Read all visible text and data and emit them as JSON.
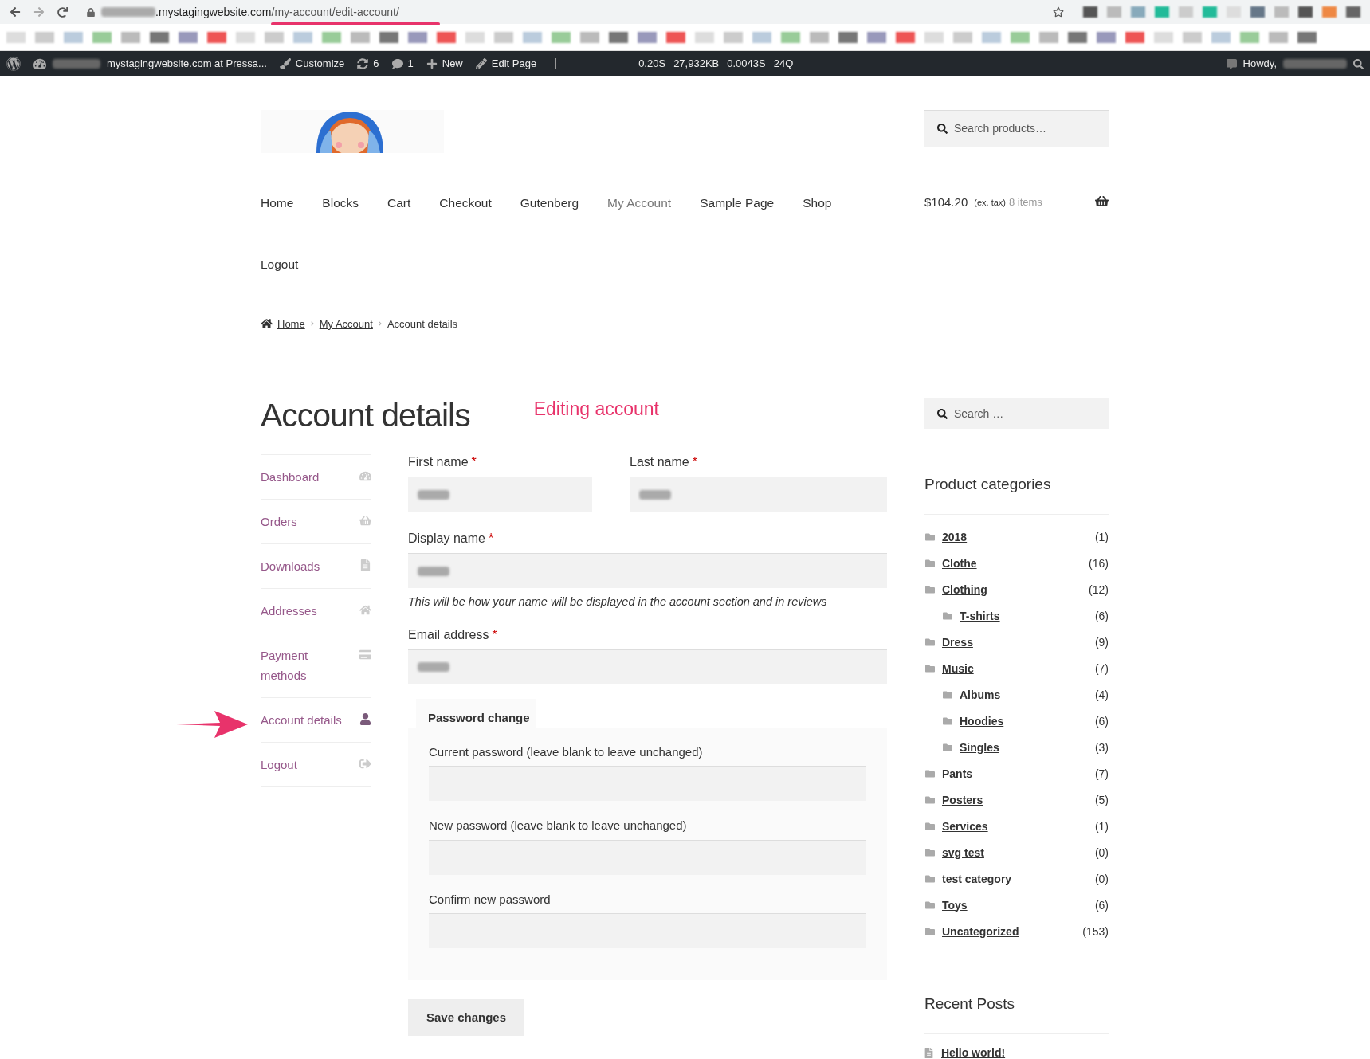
{
  "browser": {
    "url_host": ".mystagingwebsite.com",
    "url_path": "/my-account/edit-account/"
  },
  "admin_bar": {
    "site": "mystagingwebsite.com at Pressa...",
    "items": [
      {
        "kind": "customize",
        "label": "Customize"
      },
      {
        "kind": "updates",
        "label": "6"
      },
      {
        "kind": "comments",
        "label": "1"
      },
      {
        "kind": "new",
        "label": "New"
      },
      {
        "kind": "edit",
        "label": "Edit Page"
      }
    ],
    "stats": [
      "0.20S",
      "27,932KB",
      "0.0043S",
      "24Q"
    ],
    "greeting": "Howdy,"
  },
  "header": {
    "search_placeholder": "Search products…",
    "nav": [
      {
        "label": "Home",
        "selected": false
      },
      {
        "label": "Blocks",
        "selected": false
      },
      {
        "label": "Cart",
        "selected": false
      },
      {
        "label": "Checkout",
        "selected": false
      },
      {
        "label": "Gutenberg",
        "selected": false
      },
      {
        "label": "My Account",
        "selected": true
      },
      {
        "label": "Sample Page",
        "selected": false
      },
      {
        "label": "Shop",
        "selected": false
      },
      {
        "label": "Logout",
        "selected": false
      }
    ],
    "cart": {
      "total": "$104.20",
      "tax_note": "(ex. tax)",
      "count": "8 items"
    }
  },
  "breadcrumb": [
    "Home",
    "My Account",
    "Account details"
  ],
  "page": {
    "title": "Account details",
    "annotation": "Editing account"
  },
  "account_menu": [
    {
      "kind": "dashboard",
      "label": "Dashboard",
      "selected": false
    },
    {
      "kind": "orders",
      "label": "Orders",
      "selected": false
    },
    {
      "kind": "downloads",
      "label": "Downloads",
      "selected": false
    },
    {
      "kind": "addresses",
      "label": "Addresses",
      "selected": false
    },
    {
      "kind": "payment",
      "label": "Payment methods",
      "selected": false
    },
    {
      "kind": "account",
      "label": "Account details",
      "selected": true
    },
    {
      "kind": "logout",
      "label": "Logout",
      "selected": false
    }
  ],
  "form": {
    "first_name": {
      "label": "First name",
      "mark": "*"
    },
    "last_name": {
      "label": "Last name",
      "mark": "*"
    },
    "display_name": {
      "label": "Display name",
      "mark": "*",
      "hint": "This will be how your name will be displayed in the account section and in reviews"
    },
    "email": {
      "label": "Email address",
      "mark": "*"
    },
    "password": {
      "legend": "Password change",
      "fields": [
        "Current password (leave blank to leave unchanged)",
        "New password (leave blank to leave unchanged)",
        "Confirm new password"
      ]
    },
    "save": "Save changes"
  },
  "sidebar": {
    "search_placeholder": "Search …",
    "categories_title": "Product categories",
    "categories": [
      {
        "name": "2018",
        "count": "(1)"
      },
      {
        "name": "Clothe",
        "count": "(16)"
      },
      {
        "name": "Clothing",
        "count": "(12)",
        "children": [
          {
            "name": "T-shirts",
            "count": "(6)"
          }
        ]
      },
      {
        "name": "Dress",
        "count": "(9)"
      },
      {
        "name": "Music",
        "count": "(7)",
        "children": [
          {
            "name": "Albums",
            "count": "(4)"
          },
          {
            "name": "Hoodies",
            "count": "(6)"
          },
          {
            "name": "Singles",
            "count": "(3)"
          }
        ]
      },
      {
        "name": "Pants",
        "count": "(7)"
      },
      {
        "name": "Posters",
        "count": "(5)"
      },
      {
        "name": "Services",
        "count": "(1)"
      },
      {
        "name": "svg test",
        "count": "(0)"
      },
      {
        "name": "test category",
        "count": "(0)"
      },
      {
        "name": "Toys",
        "count": "(6)"
      },
      {
        "name": "Uncategorized",
        "count": "(153)"
      }
    ],
    "recent_title": "Recent Posts",
    "recent_posts": [
      "Hello world!"
    ]
  }
}
